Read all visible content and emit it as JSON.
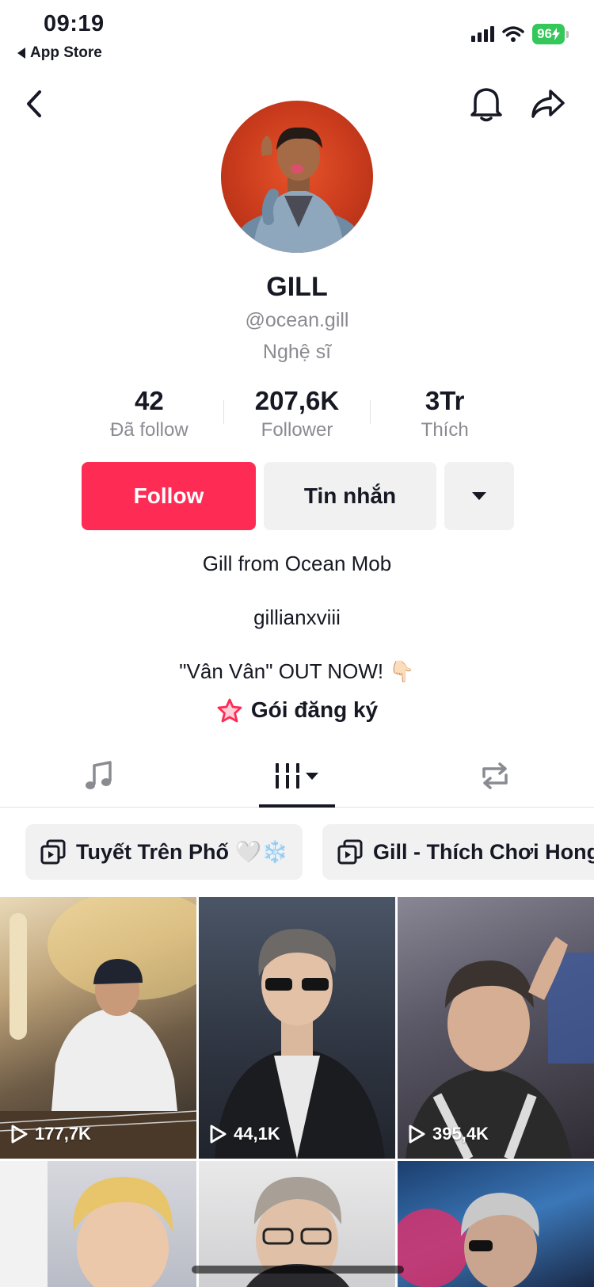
{
  "status_bar": {
    "time": "09:19",
    "back_app": "App Store",
    "battery": "96"
  },
  "header": {
    "back_icon": "chevron-left-icon",
    "bell_icon": "bell-icon",
    "share_icon": "share-arrow-icon"
  },
  "profile": {
    "name": "GILL",
    "handle": "@ocean.gill",
    "category": "Nghệ sĩ"
  },
  "stats": [
    {
      "value": "42",
      "label": "Đã follow"
    },
    {
      "value": "207,6K",
      "label": "Follower"
    },
    {
      "value": "3Tr",
      "label": "Thích"
    }
  ],
  "actions": {
    "follow": "Follow",
    "message": "Tin nhắn"
  },
  "bio": {
    "line1": "Gill from Ocean Mob",
    "line2": "gillianxviii",
    "line3": "\"Vân Vân\" OUT NOW! 👇🏻"
  },
  "subscription": {
    "label": "Gói đăng ký"
  },
  "tabs": [
    {
      "name": "music",
      "icon": "music-note-icon"
    },
    {
      "name": "videos",
      "icon": "grid-bars-icon"
    },
    {
      "name": "reposts",
      "icon": "repost-icon"
    }
  ],
  "playlists": [
    {
      "title": "Tuyết Trên Phố 🤍❄️"
    },
    {
      "title": "Gill - Thích Chơi Hong"
    }
  ],
  "videos": [
    {
      "views": "177,7K"
    },
    {
      "views": "44,1K"
    },
    {
      "views": "395,4K"
    }
  ]
}
